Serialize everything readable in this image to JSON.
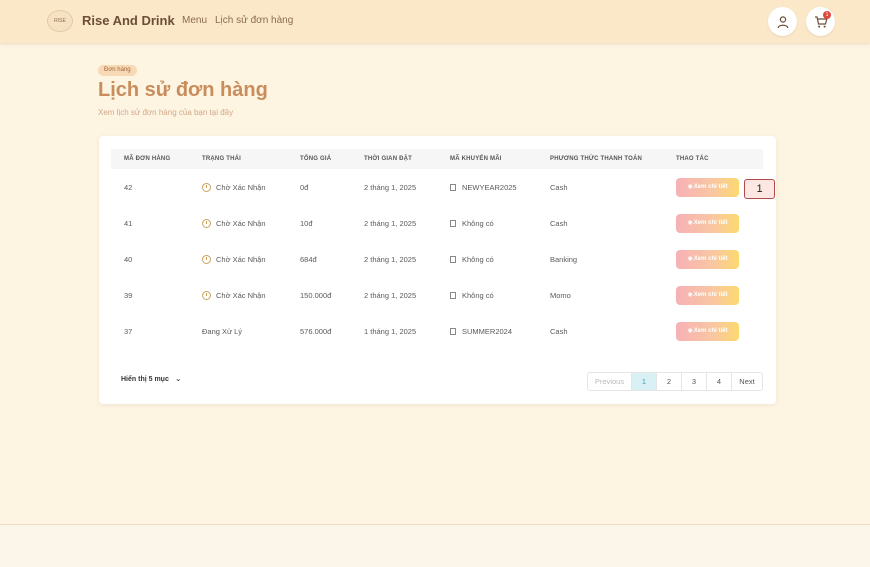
{
  "header": {
    "logo_text": "RISE",
    "brand": "Rise And Drink",
    "nav": [
      "Menu",
      "Lịch sử đơn hàng"
    ],
    "cart_count": "1"
  },
  "page": {
    "breadcrumb": "Đơn hàng",
    "title": "Lịch sử đơn hàng",
    "subtitle": "Xem lịch sử đơn hàng của bạn tại đây"
  },
  "table": {
    "headers": [
      "MÃ ĐƠN HÀNG",
      "TRẠNG THÁI",
      "TỔNG GIÁ",
      "THỜI GIAN ĐẶT",
      "MÃ KHUYẾN MÃI",
      "PHƯƠNG THỨC THANH TOÁN",
      "THAO TÁC"
    ],
    "action_label": "Xem chi tiết",
    "rows": [
      {
        "id": "42",
        "status": "Chờ Xác Nhận",
        "status_icon": true,
        "total": "0đ",
        "time": "2 tháng 1, 2025",
        "promo": "NEWYEAR2025",
        "payment": "Cash"
      },
      {
        "id": "41",
        "status": "Chờ Xác Nhận",
        "status_icon": true,
        "total": "10đ",
        "time": "2 tháng 1, 2025",
        "promo": "Không có",
        "payment": "Cash"
      },
      {
        "id": "40",
        "status": "Chờ Xác Nhận",
        "status_icon": true,
        "total": "684đ",
        "time": "2 tháng 1, 2025",
        "promo": "Không có",
        "payment": "Banking"
      },
      {
        "id": "39",
        "status": "Chờ Xác Nhận",
        "status_icon": true,
        "total": "150.000đ",
        "time": "2 tháng 1, 2025",
        "promo": "Không có",
        "payment": "Momo"
      },
      {
        "id": "37",
        "status": "Đang Xử Lý",
        "status_icon": false,
        "total": "576.000đ",
        "time": "1 tháng 1, 2025",
        "promo": "SUMMER2024",
        "payment": "Cash"
      }
    ]
  },
  "footer": {
    "page_size_label": "Hiển thị 5 mục",
    "pagination": {
      "previous": "Previous",
      "pages": [
        "1",
        "2",
        "3",
        "4"
      ],
      "active": "1",
      "next": "Next"
    }
  },
  "annotation": {
    "label": "1"
  }
}
